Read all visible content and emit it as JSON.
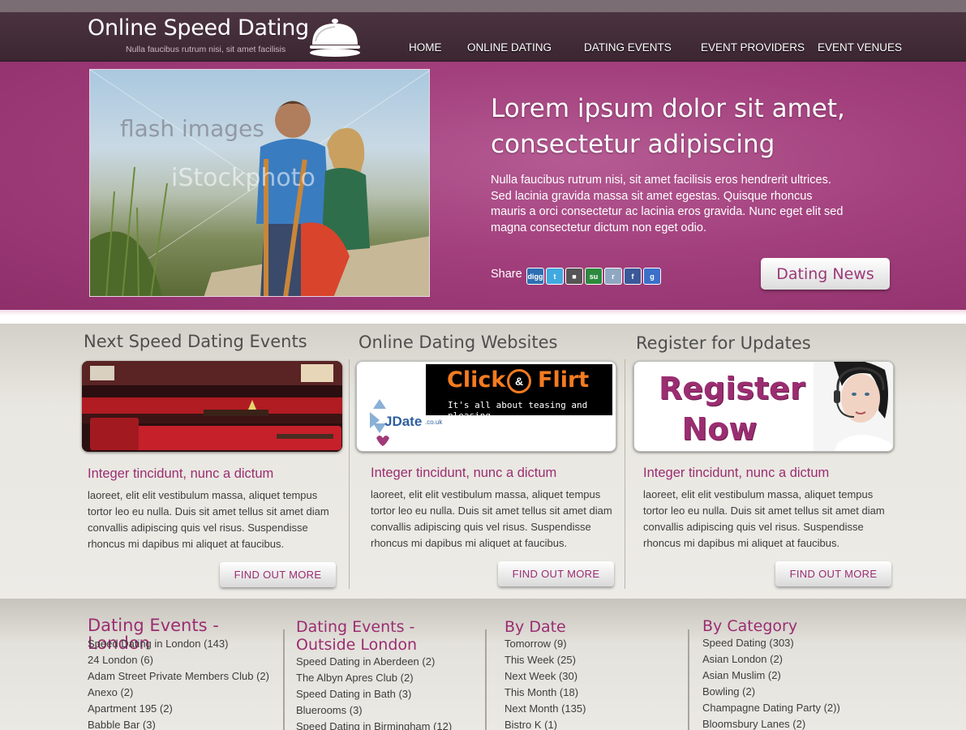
{
  "header": {
    "title": "Online Speed Dating",
    "tagline": "Nulla faucibus rutrum nisi, sit amet facilisis",
    "nav": [
      "HOME",
      "ONLINE DATING",
      "DATING EVENTS",
      "EVENT PROVIDERS",
      "EVENT VENUES"
    ]
  },
  "hero": {
    "photo_label": "flash images",
    "photo_watermark": "iStockphoto",
    "title_line1": "Lorem ipsum dolor sit amet,",
    "title_line2": "consectetur adipiscing",
    "text": "Nulla faucibus rutrum nisi, sit amet facilisis eros hendrerit ultrices. Sed lacinia gravida massa sit amet egestas. Quisque rhoncus mauris a orci consectetur ac lacinia eros gravida. Nunc eget elit sed magna consectetur dictum non eget odio.",
    "share_label": "Share",
    "share_icons": [
      {
        "name": "digg-icon",
        "glyph": "digg",
        "color": "#2d6fb3"
      },
      {
        "name": "twitter-icon",
        "glyph": "t",
        "color": "#3fa9e0"
      },
      {
        "name": "delicious-icon",
        "glyph": "■",
        "color": "#555555"
      },
      {
        "name": "stumbleupon-icon",
        "glyph": "su",
        "color": "#2c8a3e"
      },
      {
        "name": "reddit-icon",
        "glyph": "r",
        "color": "#8fa7c0"
      },
      {
        "name": "facebook-icon",
        "glyph": "f",
        "color": "#3b5998"
      },
      {
        "name": "google-icon",
        "glyph": "g",
        "color": "#3b6fc9"
      }
    ],
    "news_button": "Dating News"
  },
  "columns": [
    {
      "title": "Next Speed Dating Events",
      "subtitle": "Integer tincidunt, nunc a dictum",
      "text": "laoreet, elit elit vestibulum massa, aliquet tempus tortor leo eu nulla. Duis sit amet tellus sit amet diam convallis adipiscing quis vel risus. Suspendisse rhoncus mi dapibus mi aliquet at faucibus.",
      "button": "FIND OUT MORE"
    },
    {
      "title": "Online Dating Websites",
      "subtitle": "Integer tincidunt, nunc a dictum",
      "text": "laoreet, elit elit vestibulum massa, aliquet tempus tortor leo eu nulla. Duis sit amet tellus sit amet diam convallis adipiscing quis vel risus. Suspendisse rhoncus mi dapibus mi aliquet at faucibus.",
      "button": "FIND OUT MORE"
    },
    {
      "title": "Register for Updates",
      "subtitle": "Integer tincidunt, nunc a dictum",
      "text": "laoreet, elit elit vestibulum massa, aliquet tempus tortor leo eu nulla. Duis sit amet tellus sit amet diam convallis adipiscing quis vel risus. Suspendisse rhoncus mi dapibus mi aliquet at faucibus.",
      "button": "FIND OUT MORE"
    }
  ],
  "ads": {
    "clickflirt_click": "Click",
    "clickflirt_amp": "&",
    "clickflirt_flirt": "Flirt",
    "clickflirt_tagline": "It's all about teasing and pleasing...",
    "jdate": "JDate",
    "jdate_suffix": ".co.uk",
    "register_line1": "Register",
    "register_line2": "Now"
  },
  "footer": [
    {
      "title": "Dating Events - London",
      "items": [
        "Speed Dating in London (143)",
        "24 London (6)",
        "Adam Street Private Members Club (2)",
        "Anexo (2)",
        "Apartment 195 (2)",
        "Babble Bar (3)"
      ]
    },
    {
      "title": "Dating Events - Outside London",
      "items": [
        "Speed Dating in Aberdeen (2)",
        "The Albyn Apres Club (2)",
        "Speed Dating in Bath (3)",
        "Bluerooms (3)",
        "Speed Dating in Birmingham (12)"
      ]
    },
    {
      "title": "By Date",
      "items": [
        "Tomorrow (9)",
        "This Week (25)",
        "Next Week (30)",
        "This Month (18)",
        "Next Month (135)",
        "Bistro K (1)"
      ]
    },
    {
      "title": "By Category",
      "items": [
        "Speed Dating (303)",
        "Asian London (2)",
        "Asian Muslim (2)",
        "Bowling (2)",
        "Champagne Dating Party (2))",
        "Bloomsbury Lanes (2)"
      ]
    }
  ],
  "colors": {
    "brand_plum": "#9b2d71",
    "header_dark": "#3f2a35",
    "hero_pink": "#a23f7c"
  }
}
